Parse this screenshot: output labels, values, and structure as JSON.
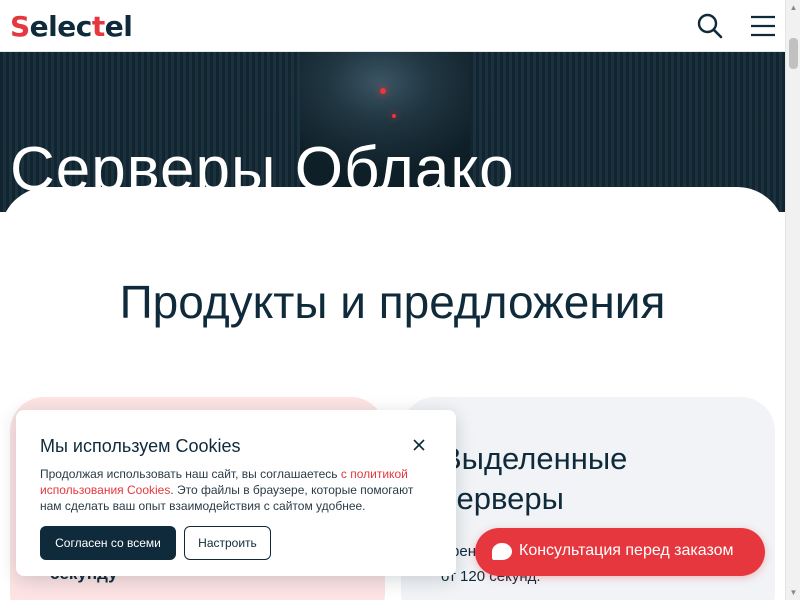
{
  "header": {
    "logo_prefix": "S",
    "logo_mid": "elec",
    "logo_accent": "t",
    "logo_suffix": "el",
    "icons": {
      "search": "search-icon",
      "menu": "hamburger-menu-icon"
    }
  },
  "hero": {
    "title": "Серверы  Облако"
  },
  "section": {
    "title": "Продукты и предложения"
  },
  "cards": {
    "left": {
      "text_fragment": "секунду"
    },
    "right": {
      "title": "Выделенные серверы",
      "line1": "Арен",
      "line2": "от 120 секунд."
    }
  },
  "cookie": {
    "title": "Мы используем Cookies",
    "text_before": "Продолжая использовать наш сайт, вы соглашаетесь ",
    "link": "с политикой использования Cookies",
    "text_after": ". Это файлы в браузере, которые помогают нам сделать ваш опыт взаимодействия с сайтом удобнее.",
    "accept_label": "Согласен со всеми",
    "config_label": "Настроить"
  },
  "consult": {
    "label": "Консультация перед заказом",
    "icon": "chat-bubble-icon"
  },
  "colors": {
    "brand": "#0f2a3a",
    "accent": "#e6373f",
    "card_pink": "#fde3e3",
    "card_grey": "#f1f3f6"
  }
}
